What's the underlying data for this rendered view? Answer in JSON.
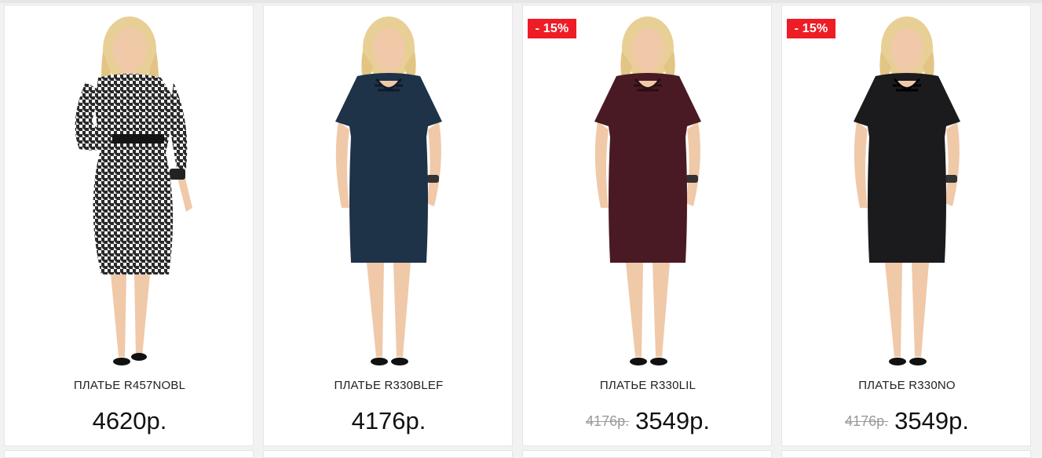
{
  "products": [
    {
      "name": "ПЛАТЬЕ R457NOBL",
      "price": "4620р.",
      "old_price": "",
      "badge": "",
      "dress_color": "#d9d9d9",
      "image_icon": "houndstooth-dress-image"
    },
    {
      "name": "ПЛАТЬЕ R330BLEF",
      "price": "4176р.",
      "old_price": "",
      "badge": "",
      "dress_color": "#1e3248",
      "image_icon": "navy-dress-image"
    },
    {
      "name": "ПЛАТЬЕ R330LIL",
      "price": "3549р.",
      "old_price": "4176р.",
      "badge": "- 15%",
      "dress_color": "#4a1a24",
      "image_icon": "burgundy-dress-image"
    },
    {
      "name": "ПЛАТЬЕ R330NO",
      "price": "3549р.",
      "old_price": "4176р.",
      "badge": "- 15%",
      "dress_color": "#1b1b1d",
      "image_icon": "black-dress-image"
    }
  ],
  "colors": {
    "badge": "#ee1c25",
    "skin": "#f0c9a9",
    "hair": "#e8cf95"
  }
}
